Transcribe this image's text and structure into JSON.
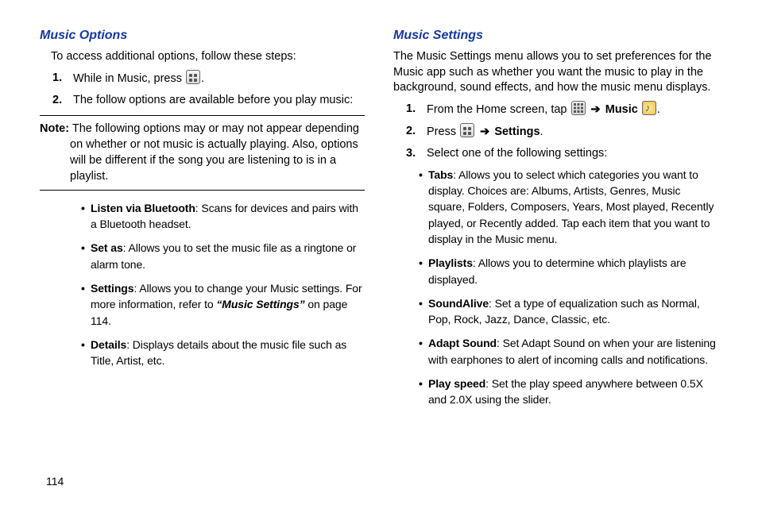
{
  "page_number": "114",
  "left": {
    "heading": "Music Options",
    "intro": "To access additional options, follow these steps:",
    "steps": [
      {
        "num": "1.",
        "pre": "While in Music, press ",
        "icon": "menu",
        "post": "."
      },
      {
        "num": "2.",
        "text": "The follow options are available before you play music:"
      }
    ],
    "note_label": "Note:",
    "note_first": "The following options may or may not appear depending",
    "note_rest": "on whether or not music is actually playing. Also, options will be different if the song you are listening to is in a playlist.",
    "bullets": [
      {
        "term": "Listen via Bluetooth",
        "desc": ": Scans for devices and pairs with a Bluetooth headset."
      },
      {
        "term": "Set as",
        "desc": ": Allows you to set the music file as a ringtone or alarm tone."
      },
      {
        "term": "Settings",
        "desc_pre": ": Allows you to change your Music settings. For more information, refer to ",
        "ref": "“Music Settings”",
        "desc_post": "  on page 114."
      },
      {
        "term": "Details",
        "desc": ": Displays details about the music file such as Title, Artist, etc."
      }
    ]
  },
  "right": {
    "heading": "Music Settings",
    "intro": "The Music Settings menu allows you to set preferences for the Music app such as whether you want the music to play in the background, sound effects, and how the music menu displays.",
    "steps": {
      "s1_pre": "From the Home screen, tap ",
      "s1_arrow": "➔",
      "s1_music": "Music",
      "s2_pre": "Press ",
      "s2_arrow": "➔",
      "s2_settings": "Settings",
      "s3": "Select one of the following settings:"
    },
    "bullets": [
      {
        "term": "Tabs",
        "desc": ": Allows you to select which categories you want to display. Choices are: Albums, Artists, Genres, Music square, Folders, Composers, Years, Most played, Recently played, or Recently added. Tap each item that you want to display in the Music menu."
      },
      {
        "term": "Playlists",
        "desc": ": Allows you to determine which playlists are displayed."
      },
      {
        "term": "SoundAlive",
        "desc": ": Set a type of equalization such as Normal, Pop, Rock, Jazz, Dance, Classic, etc."
      },
      {
        "term": "Adapt Sound",
        "desc": ": Set Adapt Sound on when your are listening with earphones to alert of incoming calls and notifications."
      },
      {
        "term": "Play speed",
        "desc": ": Set the play speed anywhere between 0.5X and 2.0X using the slider."
      }
    ]
  }
}
